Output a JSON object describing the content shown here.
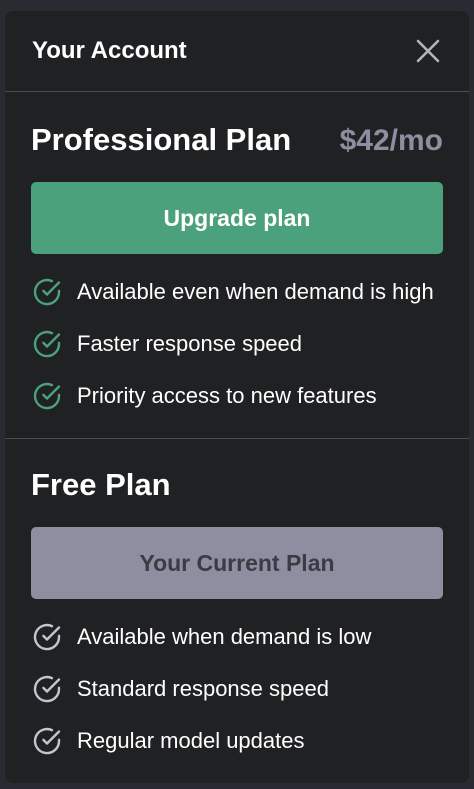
{
  "header": {
    "title": "Your Account",
    "close_icon": "close-icon"
  },
  "pro_plan": {
    "name": "Professional Plan",
    "price": "$42/mo",
    "button_label": "Upgrade plan",
    "accent_color": "#4ca17d",
    "features": [
      "Available even when demand is high",
      "Faster response speed",
      "Priority access to new features"
    ]
  },
  "free_plan": {
    "name": "Free Plan",
    "button_label": "Your Current Plan",
    "button_color": "#8e8ea0",
    "features": [
      "Available when demand is low",
      "Standard response speed",
      "Regular model updates"
    ]
  }
}
